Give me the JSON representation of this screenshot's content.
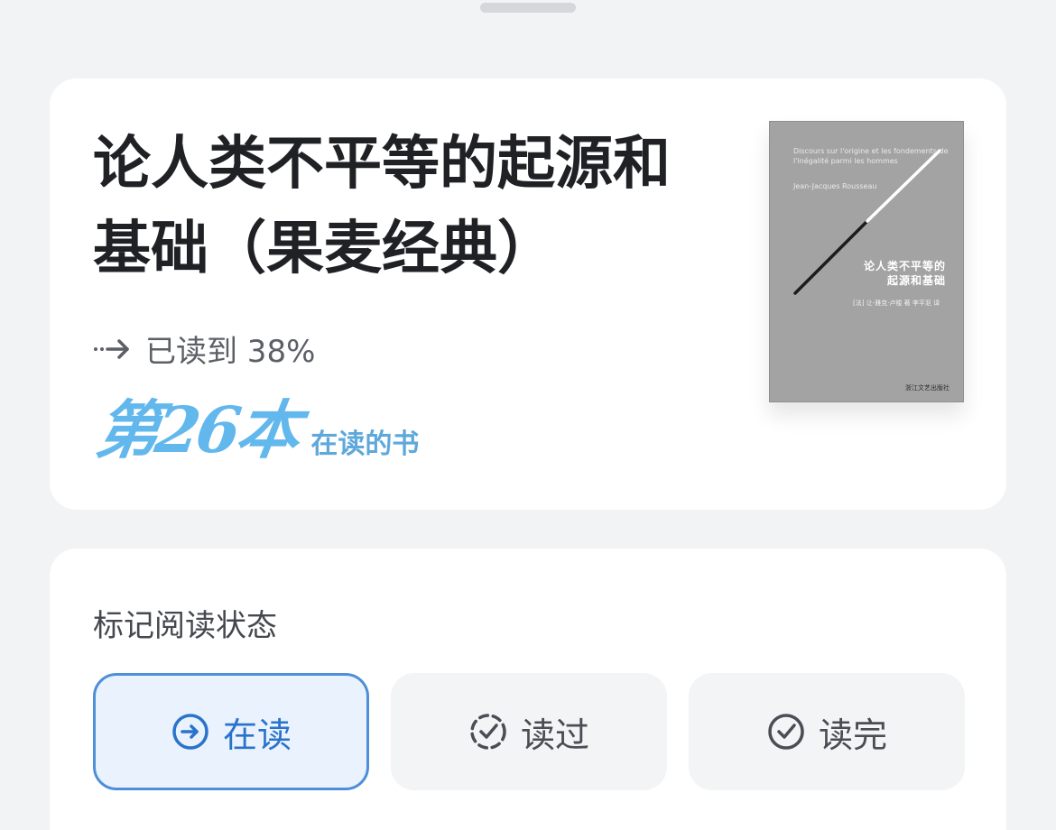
{
  "book": {
    "title": "论人类不平等的起源和基础（果麦经典）",
    "progress_text": "已读到 38%",
    "progress_value": 38,
    "reading_rank": "第26本",
    "reading_rank_label": "在读的书",
    "cover": {
      "line1": "Discours sur l'origine et les fondements de",
      "line2": "l'inégalité parmi les hommes",
      "author_en": "Jean-Jacques Rousseau",
      "title_cn": "论人类不平等的起源和基础",
      "credits": "[法] 让-雅克·卢梭 著  李平沤 译",
      "publisher": "浙江文艺出版社",
      "background_color": "#a3a3a3"
    }
  },
  "status": {
    "heading": "标记阅读状态",
    "options": [
      {
        "label": "在读",
        "icon": "arrow-circle-icon",
        "selected": true
      },
      {
        "label": "读过",
        "icon": "dashed-check-icon",
        "selected": false
      },
      {
        "label": "读完",
        "icon": "check-circle-icon",
        "selected": false
      }
    ],
    "accent_color": "#4e8fd8"
  }
}
